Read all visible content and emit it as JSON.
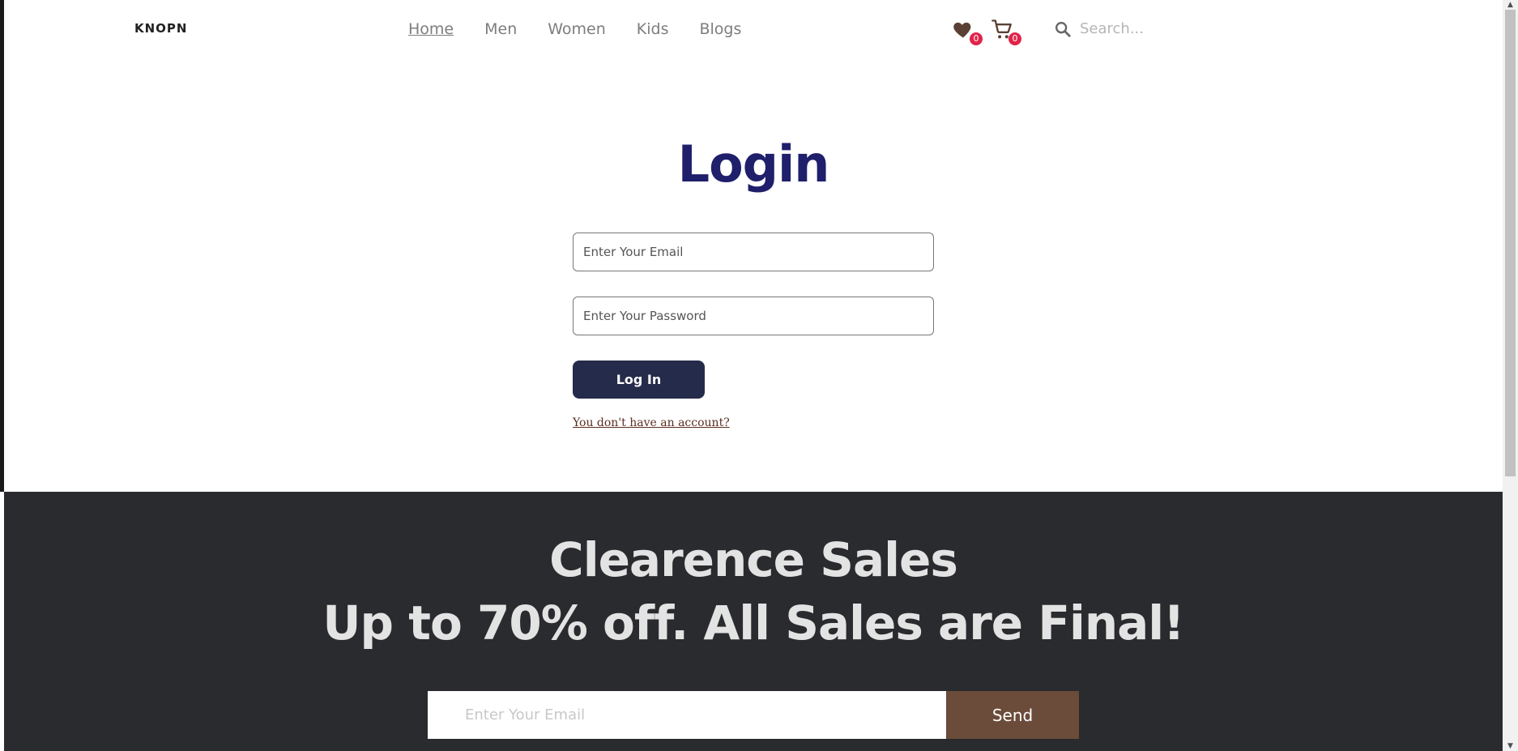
{
  "header": {
    "logo": "KNOPN",
    "nav": [
      "Home",
      "Men",
      "Women",
      "Kids",
      "Blogs"
    ],
    "wishlist_count": "0",
    "cart_count": "0",
    "search_placeholder": "Search..."
  },
  "login": {
    "title": "Login",
    "email_placeholder": "Enter Your Email",
    "password_placeholder": "Enter Your Password",
    "button_label": "Log In",
    "signup_link": "You don't have an account?"
  },
  "banner": {
    "line1": "Clearence Sales",
    "line2": "Up to 70% off. All Sales are Final!",
    "email_placeholder": "Enter Your Email",
    "send_label": "Send"
  },
  "colors": {
    "title": "#1f1f6b",
    "login_button": "#252b4a",
    "banner_bg": "#2a2b2e",
    "send_button": "#6b4c3a",
    "badge": "#e0244a",
    "icons": "#5b4034"
  }
}
